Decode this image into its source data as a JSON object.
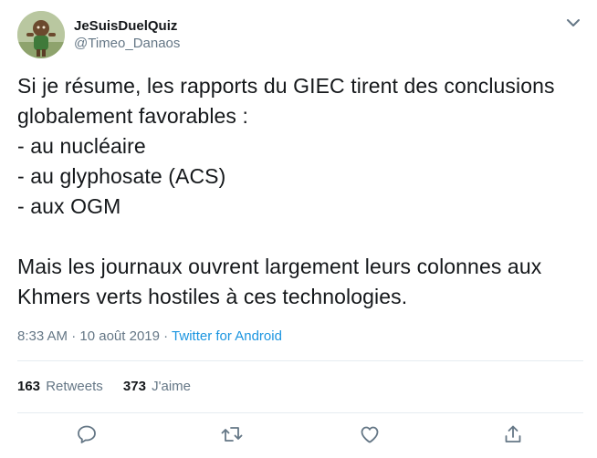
{
  "user": {
    "display_name": "JeSuisDuelQuiz",
    "handle": "@Timeo_Danaos"
  },
  "tweet": {
    "text": "Si je résume, les rapports du GIEC tirent des conclusions globalement favorables :\n- au nucléaire\n- au glyphosate (ACS)\n- aux OGM\n\nMais les journaux ouvrent largement leurs colonnes aux Khmers verts hostiles à ces technologies.",
    "time": "8:33 AM",
    "separator": " · ",
    "date": "10 août 2019",
    "source": "Twitter for Android"
  },
  "stats": {
    "retweets_count": "163",
    "retweets_label": "Retweets",
    "likes_count": "373",
    "likes_label": "J'aime"
  },
  "icons": {
    "caret": "chevron-down-icon",
    "reply": "reply-icon",
    "retweet": "retweet-icon",
    "like": "heart-icon",
    "share": "share-icon"
  },
  "colors": {
    "text": "#14171a",
    "secondary": "#657786",
    "link": "#1b95e0",
    "divider": "#e6ecf0"
  }
}
